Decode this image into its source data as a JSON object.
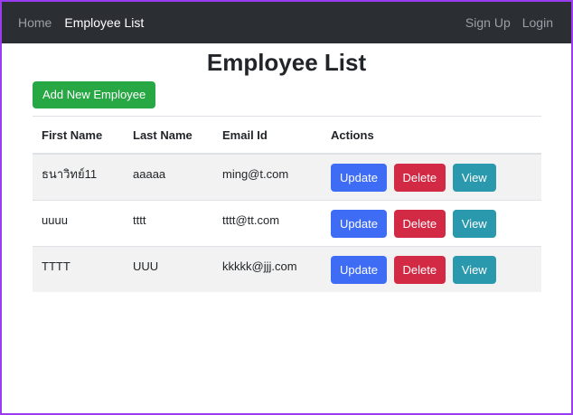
{
  "navbar": {
    "home": "Home",
    "brand": "Employee List",
    "signup": "Sign Up",
    "login": "Login"
  },
  "page": {
    "title": "Employee List",
    "add_button": "Add New Employee"
  },
  "table": {
    "headers": [
      "First Name",
      "Last Name",
      "Email Id",
      "Actions"
    ],
    "rows": [
      {
        "first": "ธนาวิทย์11",
        "last": "aaaaa",
        "email": "ming@t.com"
      },
      {
        "first": "uuuu",
        "last": "tttt",
        "email": "tttt@tt.com"
      },
      {
        "first": "TTTT",
        "last": "UUU",
        "email": "kkkkk@jjj.com"
      }
    ],
    "actions": {
      "update": "Update",
      "delete": "Delete",
      "view": "View"
    }
  },
  "colors": {
    "navbar_bg": "#2b2e33",
    "add": "#28a745",
    "update": "#3f6cf5",
    "delete": "#d22a45",
    "view": "#2a98ad"
  }
}
